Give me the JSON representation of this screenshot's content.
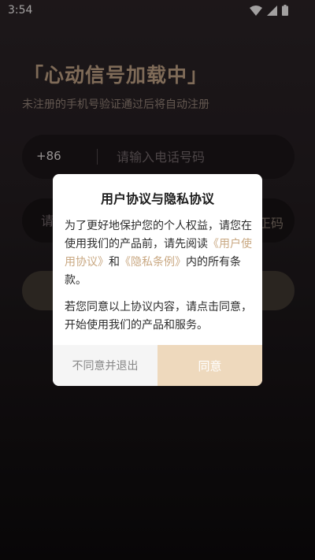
{
  "status_bar": {
    "time": "3:54",
    "icons": [
      "wifi-icon",
      "cellular-signal-icon",
      "battery-icon"
    ]
  },
  "login": {
    "title": "「心动信号加载中」",
    "subtitle": "未注册的手机号验证通过后将自动注册",
    "country_code": "+86",
    "phone_placeholder": "请输入电话号码",
    "code_placeholder_visible": "请",
    "get_code_visible": "正码"
  },
  "dialog": {
    "title": "用户协议与隐私协议",
    "para1_prefix": "为了更好地保护您的个人权益，请您在使用我们的产品前，请先阅读",
    "link_user_agreement": "《用户使用协议》",
    "para1_and": "和",
    "link_privacy": "《隐私条例》",
    "para1_suffix": "内的所有条款。",
    "para2": "若您同意以上协议内容，请点击同意，开始使用我们的产品和服务。",
    "decline_label": "不同意并退出",
    "agree_label": "同意"
  },
  "colors": {
    "accent_gold": "#b79a7e",
    "link": "#c9a882",
    "agree_button": "#eed9bd"
  }
}
